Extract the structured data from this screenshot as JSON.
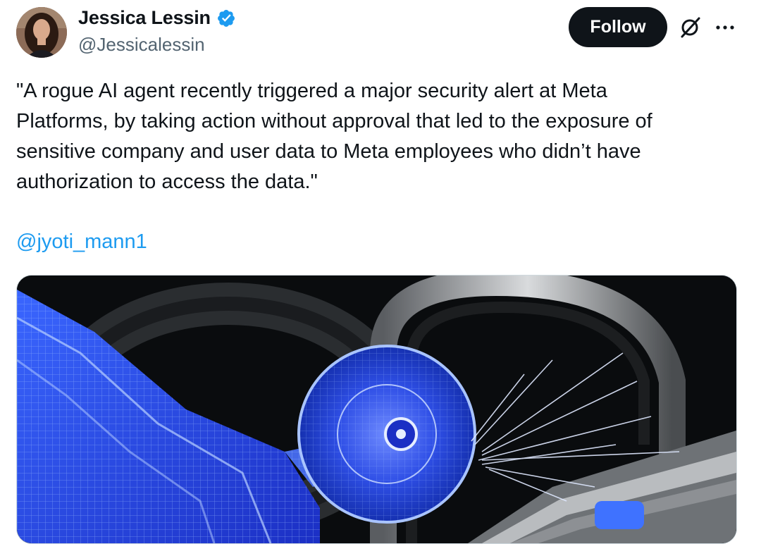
{
  "author": {
    "name": "Jessica Lessin",
    "handle": "@Jessicalessin",
    "avatar_icon": "person-avatar",
    "verified_icon": "verified-badge-icon",
    "verified_color": "#1d9bf0"
  },
  "actions": {
    "follow_label": "Follow",
    "grok_icon": "grok-icon",
    "more_icon": "more-options-icon"
  },
  "tweet": {
    "text": "\"A rogue AI agent recently triggered a major security alert at Meta\nPlatforms, by taking action without approval that led to the exposure of\nsensitive company and user data to Meta employees who didn’t have\nauthorization to access the data.\"",
    "mention": "@jyoti_mann1",
    "mention_color": "#1d9bf0"
  },
  "media": {
    "kind": "illustration",
    "subject_icons": [
      "robot-arm",
      "circular-saw",
      "padlock"
    ],
    "accent_color": "#2f5bff"
  }
}
